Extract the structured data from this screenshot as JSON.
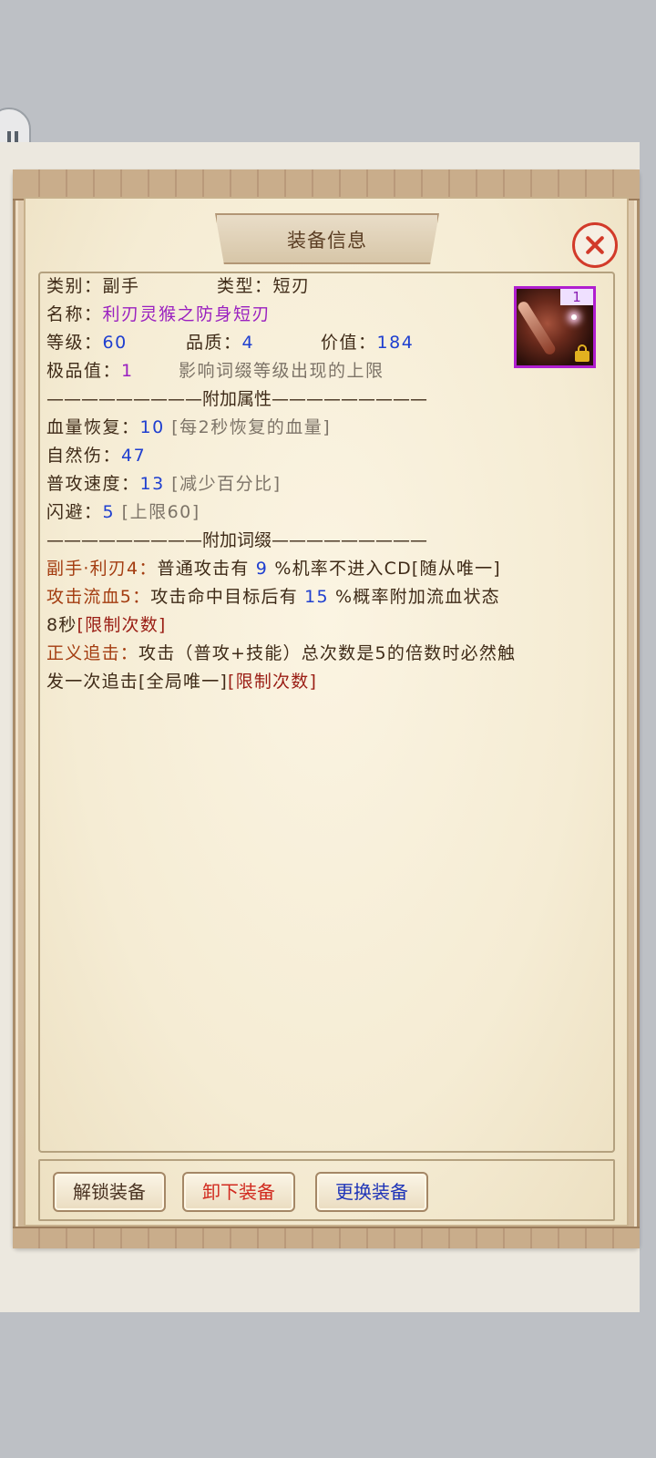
{
  "dialog": {
    "title": "装备信息"
  },
  "item": {
    "icon_count": "1",
    "category_label": "类别：",
    "category_value": "副手",
    "type_label": "类型：",
    "type_value": "短刃",
    "name_label": "名称：",
    "name_value": "利刃灵猴之防身短刃",
    "level_label": "等级：",
    "level_value": "60",
    "quality_label": "品质：",
    "quality_value": "4",
    "price_label": "价值：",
    "price_value": "184",
    "grade_label": "极品值：",
    "grade_value": "1",
    "grade_note": "影响词缀等级出现的上限"
  },
  "sections": {
    "attrs_header": "—————————附加属性—————————",
    "affix_header": "—————————附加词缀—————————"
  },
  "attributes": [
    {
      "label": "血量恢复：",
      "value": "10",
      "note": "[每2秒恢复的血量]"
    },
    {
      "label": "自然伤：",
      "value": "47",
      "note": ""
    },
    {
      "label": "普攻速度：",
      "value": "13",
      "note": "[减少百分比]"
    },
    {
      "label": "闪避：",
      "value": "5",
      "note": "[上限60]"
    }
  ],
  "affixes": {
    "a1_name": "副手·利刃4：",
    "a1_pre": "普通攻击有",
    "a1_val": "9",
    "a1_post": "%机率不进入CD[随从唯一]",
    "a2_name": "攻击流血5：",
    "a2_pre": "攻击命中目标后有",
    "a2_val": "15",
    "a2_post": "%概率附加流血状态",
    "a2_line2_pre": "8秒",
    "a2_line2_tag": "[限制次数]",
    "a3_name": "正义追击：",
    "a3_text": "攻击（普攻+技能）总次数是5的倍数时必然触",
    "a3_line2_pre": "发一次追击[全局唯一]",
    "a3_line2_tag": "[限制次数]"
  },
  "buttons": {
    "unlock": "解锁装备",
    "unequip": "卸下装备",
    "replace": "更换装备"
  },
  "icons": [
    "pause-icon",
    "close-icon",
    "dagger-item-icon",
    "lock-icon"
  ],
  "colors": {
    "value_blue": "#1f3fd0",
    "name_purple": "#9a20c0",
    "affix_brown": "#a33c10",
    "tag_maroon": "#9a1d14",
    "close_red": "#d23a2a"
  }
}
